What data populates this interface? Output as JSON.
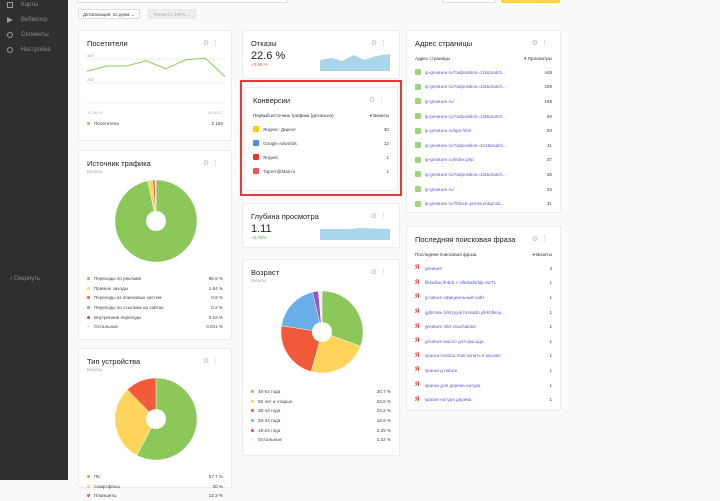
{
  "sidebar": {
    "items": [
      {
        "label": "Карты",
        "icon": "map-icon"
      },
      {
        "label": "Вебвизор",
        "icon": "play-icon"
      },
      {
        "label": "Сегменты",
        "icon": "segments-icon"
      },
      {
        "label": "Настройка",
        "icon": "gear-icon"
      }
    ],
    "collapse": "‹ Свернуть"
  },
  "filters": {
    "detail": "Детализация: по дням ⌄",
    "accuracy": "Точность: 100% ⌄"
  },
  "visitors": {
    "title": "Посетители",
    "y_ticks": [
      "400",
      "200"
    ],
    "x_labels": [
      "12.06.17",
      "18.06.17"
    ],
    "legend": "Посетители",
    "total": "2 166",
    "series": [
      330,
      360,
      360,
      390,
      345,
      395,
      405,
      300
    ],
    "color": "#8fc860"
  },
  "bounce": {
    "title": "Отказы",
    "value": "22.6 %",
    "delta": "+3.66 %",
    "delta_color": "#e55"
  },
  "conversions": {
    "title": "Конверсии",
    "col1": "Первый источник трафика (детально)",
    "col2": "▾ Визиты",
    "rows": [
      {
        "label": "Яндекс: Директ",
        "value": "30",
        "color": "#ffcc00"
      },
      {
        "label": "Google Adwords",
        "value": "12",
        "color": "#4a90e2"
      },
      {
        "label": "Яндекс",
        "value": "1",
        "color": "#e33"
      },
      {
        "label": "Таргет@Mail.ru",
        "value": "1",
        "color": "#e55"
      }
    ]
  },
  "depth": {
    "title": "Глубина просмотра",
    "value": "1.11",
    "delta": "+2.75%",
    "delta_color": "#5a5"
  },
  "traffic": {
    "title": "Источник трафика",
    "subtitle": "Визиты",
    "items": [
      {
        "label": "Переходы по рекламе",
        "value": "96.5 %",
        "pct": 96.5,
        "color": "#8cc75a"
      },
      {
        "label": "Прямые заходы",
        "value": "1.84 %",
        "pct": 1.84,
        "color": "#ffd45a"
      },
      {
        "label": "Переходы из поисковых систем",
        "value": "0.9 %",
        "pct": 0.9,
        "color": "#f25a3c"
      },
      {
        "label": "Переходы по ссылкам на сайтах",
        "value": "0.2 %",
        "pct": 0.2,
        "color": "#6aaee8"
      },
      {
        "label": "Внутренние переходы",
        "value": "0.16 %",
        "pct": 0.16,
        "color": "#9b4fc8"
      },
      {
        "label": "Остальные",
        "value": "0.041 %",
        "pct": 0.041,
        "color": "#f0f0d0"
      }
    ]
  },
  "device": {
    "title": "Тип устройства",
    "subtitle": "Визиты",
    "items": [
      {
        "label": "ПК",
        "value": "57.7 %",
        "pct": 57.7,
        "color": "#8cc75a"
      },
      {
        "label": "Смартфоны",
        "value": "30 %",
        "pct": 30,
        "color": "#ffd45a"
      },
      {
        "label": "Планшеты",
        "value": "12.3 %",
        "pct": 12.3,
        "color": "#f25a3c"
      }
    ]
  },
  "age": {
    "title": "Возраст",
    "subtitle": "Визиты",
    "items": [
      {
        "label": "45-54 года",
        "value": "30.7 %",
        "pct": 30.7,
        "color": "#8cc75a"
      },
      {
        "label": "55 лет и старше",
        "value": "23.6 %",
        "pct": 23.6,
        "color": "#ffd45a"
      },
      {
        "label": "35-44 года",
        "value": "23.2 %",
        "pct": 23.2,
        "color": "#f25a3c"
      },
      {
        "label": "25-34 года",
        "value": "18.9 %",
        "pct": 18.9,
        "color": "#6aaee8"
      },
      {
        "label": "18-24 года",
        "value": "2.25 %",
        "pct": 2.25,
        "color": "#9b4fc8"
      },
      {
        "label": "Остальные",
        "value": "1.42 %",
        "pct": 1.42,
        "color": "#f0f0f0"
      }
    ]
  },
  "pages": {
    "title": "Адрес страницы",
    "col1": "Адрес страницы",
    "col2": "▾ Просмотры",
    "rows": [
      {
        "label": "ip-greature.ru/?adposition=1t1&match...",
        "value": "448"
      },
      {
        "label": "ip-greature.ru/?adposition=1t2&match...",
        "value": "208"
      },
      {
        "label": "ip-greature.ru/",
        "value": "169"
      },
      {
        "label": "ip-greature.ru/?adposition=1t3&match...",
        "value": "69"
      },
      {
        "label": "ip-greature.ru/spn.html",
        "value": "63"
      },
      {
        "label": "ip-greature.ru/?adposition=1s1&match...",
        "value": "41"
      },
      {
        "label": "ip-greature.ru/index.php",
        "value": "37"
      },
      {
        "label": "ip-greature.ru/?adposition=1t2&match...",
        "value": "36"
      },
      {
        "label": "ip-greature.ru/",
        "value": "34"
      },
      {
        "label": "ip-greature.ru/?block=premium&posit...",
        "value": "31"
      }
    ]
  },
  "phrases": {
    "title": "Последняя поисковая фраза",
    "col1": "Последняя поисковая фраза",
    "col2": "▾ Визиты",
    "rows": [
      {
        "label": "greature",
        "value": "3"
      },
      {
        "label": "fikkalbal ifnbrb c ollntkalbrfdp sw71",
        "value": "1"
      },
      {
        "label": "g-nature официальный сайт",
        "value": "1"
      },
      {
        "label": "gjibcrare fdntzyyal bcrkabb yllrkhfleny...",
        "value": "1"
      },
      {
        "label": "greature 450 vnachalatur",
        "value": "1"
      },
      {
        "label": "greature масло для фасада",
        "value": "1"
      },
      {
        "label": "краска nordica matt купить в москве",
        "value": "1"
      },
      {
        "label": "краски g nature",
        "value": "1"
      },
      {
        "label": "краски для дерева натура",
        "value": "1"
      },
      {
        "label": "краски натура дерева",
        "value": "1"
      }
    ]
  }
}
